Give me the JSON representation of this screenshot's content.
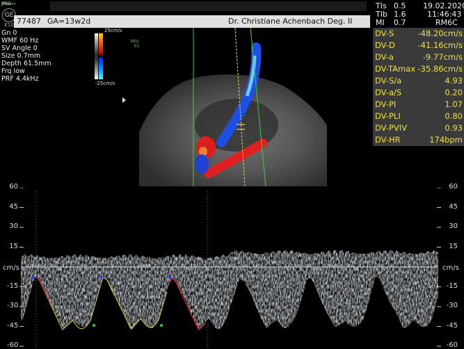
{
  "header": {
    "patient_id": "77487",
    "ga": "GA=13w2d",
    "physician": "Dr. Christiane Achenbach Deg. II"
  },
  "logo": {
    "top": "Voluson",
    "mark": "GE",
    "sub": "E10",
    "tag": "JPEG"
  },
  "system_params": [
    {
      "label": "TIs",
      "value": "0.5"
    },
    {
      "label": "TIb",
      "value": "1.6"
    },
    {
      "label": "MI",
      "value": "0.7"
    }
  ],
  "date": "19.02.2020",
  "time": "11:46:43",
  "probe": "RM6C",
  "left_params": [
    "Gn  0",
    "WMF 60 Hz",
    "SV Angle  0",
    "Size  0.7mm",
    "Depth 61.5mm",
    "Frq low",
    "PRF  4.4kHz"
  ],
  "colorbar": {
    "top_label": "25cm/s",
    "bottom_label": "-25cm/s"
  },
  "volume_label": {
    "line1": "Voluson",
    "line2": "E10"
  },
  "measurements": [
    {
      "label": "DV-S",
      "value": "-48.20cm/s"
    },
    {
      "label": "DV-D",
      "value": "-41.16cm/s"
    },
    {
      "label": "DV-a",
      "value": "-9.77cm/s"
    },
    {
      "label": "DV-TAmax",
      "value": "-35.86cm/s"
    },
    {
      "label": "DV-S/a",
      "value": "4.93"
    },
    {
      "label": "DV-a/S",
      "value": "0.20"
    },
    {
      "label": "DV-PI",
      "value": "1.07"
    },
    {
      "label": "DV-PLI",
      "value": "0.80"
    },
    {
      "label": "DV-PVIV",
      "value": "0.93"
    },
    {
      "label": "DV-HR",
      "value": "174bpm"
    }
  ],
  "spectrum": {
    "unit": "cm/s",
    "ticks": [
      "60",
      "45",
      "30",
      "15",
      "-15",
      "-30",
      "-45",
      "-60"
    ]
  },
  "colors": {
    "meas_text": "#f0e040",
    "meas_bg": "#3a3a3a",
    "trace_yellow": "#d8d040",
    "trace_red": "#e02020"
  }
}
